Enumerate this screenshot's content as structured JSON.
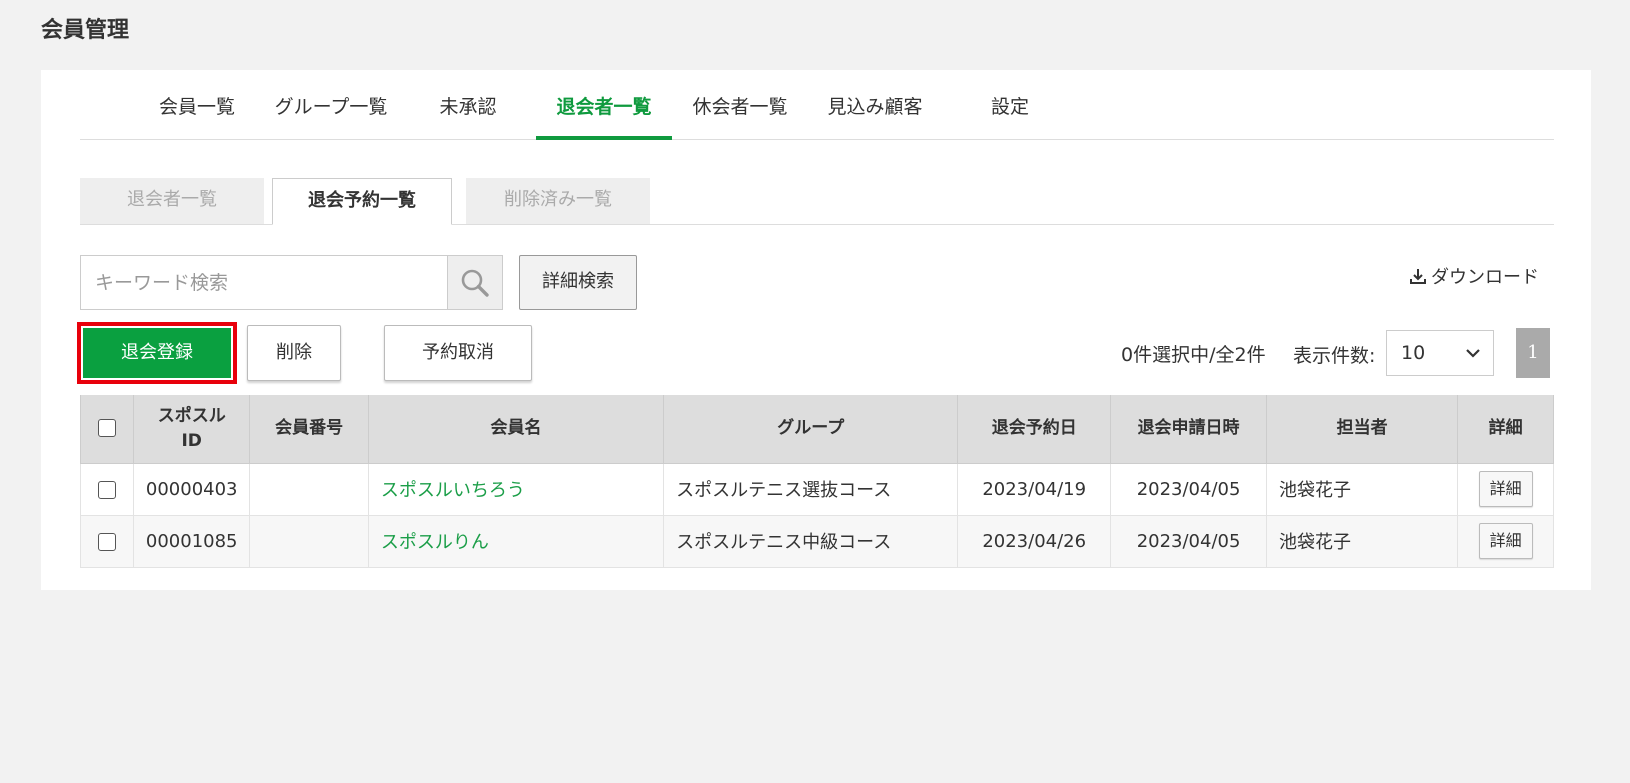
{
  "page": {
    "title": "会員管理"
  },
  "main_tabs": [
    {
      "label": "会員一覧"
    },
    {
      "label": "グループ一覧"
    },
    {
      "label": "未承認"
    },
    {
      "label": "退会者一覧"
    },
    {
      "label": "休会者一覧"
    },
    {
      "label": "見込み顧客"
    },
    {
      "label": "設定"
    }
  ],
  "active_main_tab": "退会者一覧",
  "sub_tabs": [
    {
      "label": "退会者一覧"
    },
    {
      "label": "退会予約一覧"
    },
    {
      "label": "削除済み一覧"
    }
  ],
  "active_sub_tab": "退会予約一覧",
  "search": {
    "placeholder": "キーワード検索",
    "value": ""
  },
  "toolbar": {
    "detail_search_label": "詳細検索",
    "download_label": "ダウンロード",
    "register_label": "退会登録",
    "delete_label": "削除",
    "cancel_reservation_label": "予約取消",
    "selection_info": "0件選択中/全2件",
    "per_page_label": "表示件数:",
    "per_page_value": "10",
    "current_page": "1"
  },
  "table": {
    "headers": {
      "id_line1": "スポスル",
      "id_line2": "ID",
      "member_no": "会員番号",
      "member_name": "会員名",
      "group": "グループ",
      "reserved_date": "退会予約日",
      "applied_at": "退会申請日時",
      "staff": "担当者",
      "detail": "詳細"
    },
    "rows": [
      {
        "id": "00000403",
        "member_no": "",
        "name": "スポスルいちろう",
        "group": "スポスルテニス選抜コース",
        "reserved_date": "2023/04/19",
        "applied_at": "2023/04/05",
        "staff": "池袋花子",
        "detail": "詳細"
      },
      {
        "id": "00001085",
        "member_no": "",
        "name": "スポスルりん",
        "group": "スポスルテニス中級コース",
        "reserved_date": "2023/04/26",
        "applied_at": "2023/04/05",
        "staff": "池袋花子",
        "detail": "詳細"
      }
    ]
  },
  "colors": {
    "accent": "#0f9a3e",
    "primary_button": "#0aa040",
    "highlight_border": "#e8000b",
    "link": "#1b9e48"
  }
}
